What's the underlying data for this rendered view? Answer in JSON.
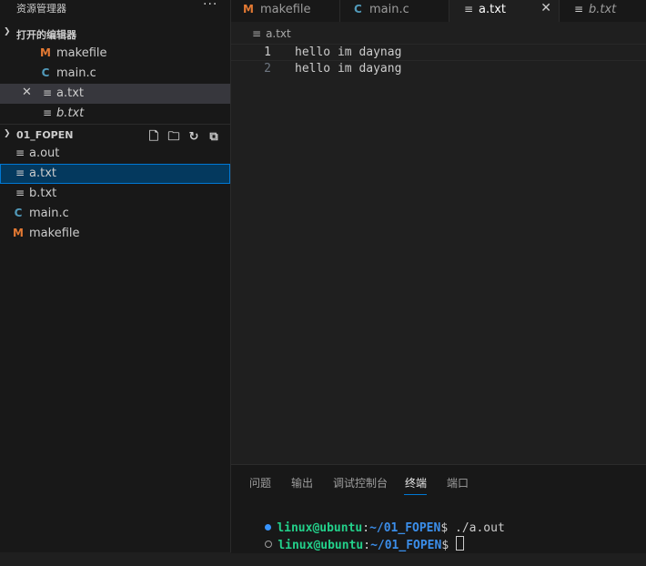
{
  "sidebar": {
    "title": "资源管理器",
    "more_label": "···",
    "open_editors": {
      "header": "打开的编辑器",
      "items": [
        {
          "icon": "M",
          "label": "makefile"
        },
        {
          "icon": "C",
          "label": "main.c"
        },
        {
          "icon": "≡",
          "label": "a.txt",
          "close": "✕"
        },
        {
          "icon": "≡",
          "label": "b.txt"
        }
      ]
    },
    "folder": {
      "header": "01_FOPEN",
      "files": [
        {
          "icon": "≡",
          "label": "a.out"
        },
        {
          "icon": "≡",
          "label": "a.txt"
        },
        {
          "icon": "≡",
          "label": "b.txt"
        },
        {
          "icon": "C",
          "label": "main.c"
        },
        {
          "icon": "M",
          "label": "makefile"
        }
      ]
    }
  },
  "tabs": [
    {
      "icon": "M",
      "label": "makefile"
    },
    {
      "icon": "C",
      "label": "main.c"
    },
    {
      "icon": "≡",
      "label": "a.txt",
      "close": "✕"
    },
    {
      "icon": "≡",
      "label": "b.txt"
    }
  ],
  "breadcrumb": {
    "icon": "≡",
    "label": "a.txt"
  },
  "editor": {
    "lines": [
      {
        "num": "1",
        "text": "hello im daynag"
      },
      {
        "num": "2",
        "text": "hello im dayang"
      }
    ]
  },
  "panel": {
    "tabs": [
      "问题",
      "输出",
      "调试控制台",
      "终端",
      "端口"
    ],
    "terminal": [
      {
        "user": "linux@ubuntu",
        "sep": ":",
        "path": "~/01_FOPEN",
        "prompt": "$ ",
        "cmd": "./a.out"
      },
      {
        "user": "linux@ubuntu",
        "sep": ":",
        "path": "~/01_FOPEN",
        "prompt": "$ ",
        "cmd": ""
      }
    ]
  },
  "colors": {
    "accent": "#0078d4",
    "makefile_icon": "#e37933",
    "c_icon": "#519aba",
    "terminal_user": "#23d18b",
    "terminal_path": "#3b8eea"
  }
}
